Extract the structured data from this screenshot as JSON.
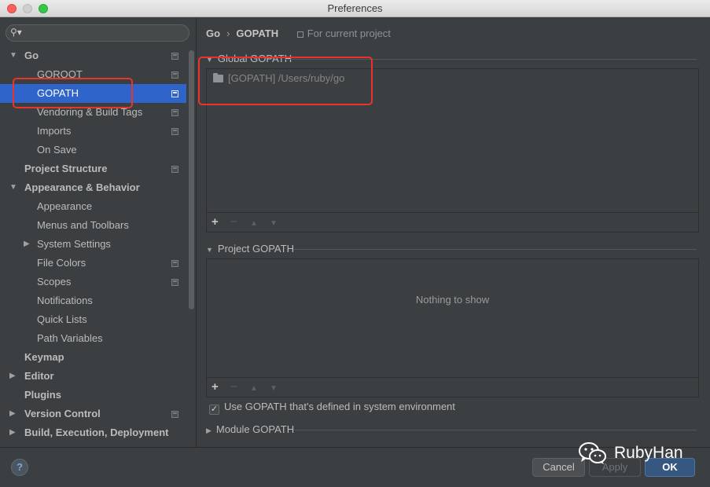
{
  "window": {
    "title": "Preferences"
  },
  "search": {
    "value": "",
    "placeholder": ""
  },
  "tree": [
    {
      "label": "Go",
      "level": 0,
      "arrow": "▼",
      "bold": true,
      "project_icon": true
    },
    {
      "label": "GOROOT",
      "level": 1,
      "arrow": "",
      "bold": false,
      "project_icon": true
    },
    {
      "label": "GOPATH",
      "level": 1,
      "arrow": "",
      "bold": false,
      "project_icon": true,
      "selected": true
    },
    {
      "label": "Vendoring & Build Tags",
      "level": 1,
      "arrow": "",
      "bold": false,
      "project_icon": true
    },
    {
      "label": "Imports",
      "level": 1,
      "arrow": "",
      "bold": false,
      "project_icon": true
    },
    {
      "label": "On Save",
      "level": 1,
      "arrow": "",
      "bold": false,
      "project_icon": false
    },
    {
      "label": "Project Structure",
      "level": 0,
      "arrow": "",
      "bold": true,
      "project_icon": true
    },
    {
      "label": "Appearance & Behavior",
      "level": 0,
      "arrow": "▼",
      "bold": true,
      "project_icon": false
    },
    {
      "label": "Appearance",
      "level": 1,
      "arrow": "",
      "bold": false,
      "project_icon": false
    },
    {
      "label": "Menus and Toolbars",
      "level": 1,
      "arrow": "",
      "bold": false,
      "project_icon": false
    },
    {
      "label": "System Settings",
      "level": 1,
      "arrow": "▶",
      "bold": false,
      "project_icon": false
    },
    {
      "label": "File Colors",
      "level": 1,
      "arrow": "",
      "bold": false,
      "project_icon": true
    },
    {
      "label": "Scopes",
      "level": 1,
      "arrow": "",
      "bold": false,
      "project_icon": true
    },
    {
      "label": "Notifications",
      "level": 1,
      "arrow": "",
      "bold": false,
      "project_icon": false
    },
    {
      "label": "Quick Lists",
      "level": 1,
      "arrow": "",
      "bold": false,
      "project_icon": false
    },
    {
      "label": "Path Variables",
      "level": 1,
      "arrow": "",
      "bold": false,
      "project_icon": false
    },
    {
      "label": "Keymap",
      "level": 0,
      "arrow": "",
      "bold": true,
      "project_icon": false
    },
    {
      "label": "Editor",
      "level": 0,
      "arrow": "▶",
      "bold": true,
      "project_icon": false
    },
    {
      "label": "Plugins",
      "level": 0,
      "arrow": "",
      "bold": true,
      "project_icon": false
    },
    {
      "label": "Version Control",
      "level": 0,
      "arrow": "▶",
      "bold": true,
      "project_icon": true
    },
    {
      "label": "Build, Execution, Deployment",
      "level": 0,
      "arrow": "▶",
      "bold": true,
      "project_icon": false
    }
  ],
  "breadcrumb": {
    "parent": "Go",
    "separator": "›",
    "current": "GOPATH",
    "scope": "For current project"
  },
  "global_gopath": {
    "title": "Global GOPATH",
    "entries": [
      "[GOPATH] /Users/ruby/go"
    ]
  },
  "project_gopath": {
    "title": "Project GOPATH",
    "empty_text": "Nothing to show"
  },
  "toolbar": {
    "add": "+",
    "remove": "−",
    "up": "▲",
    "down": "▼"
  },
  "use_system_gopath": {
    "label": "Use GOPATH that's defined in system environment",
    "checked": true
  },
  "module_gopath": {
    "title": "Module GOPATH"
  },
  "footer": {
    "help": "?",
    "cancel": "Cancel",
    "apply": "Apply",
    "ok": "OK"
  },
  "watermark": {
    "text": "RubyHan"
  },
  "colors": {
    "background": "#3c3f41",
    "selection": "#2f65ca",
    "ok_button": "#365880",
    "annotation_red": "#e9342b"
  }
}
